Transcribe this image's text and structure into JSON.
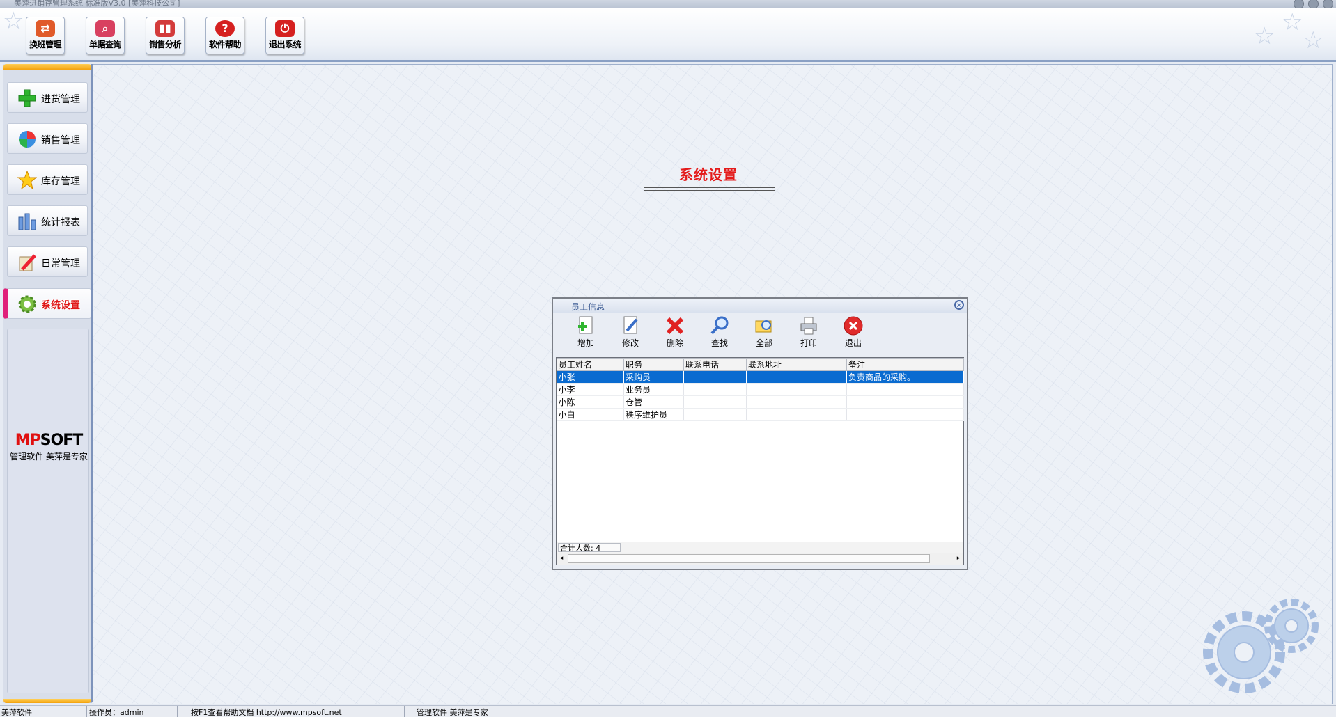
{
  "window": {
    "title": "美萍进销存管理系统 标准版V3.0 [美萍科技公司]"
  },
  "toolbar": {
    "buttons": [
      {
        "label": "换班管理",
        "icon": "shift-change-icon",
        "color": "#e05a2a"
      },
      {
        "label": "单据查询",
        "icon": "magnifier-icon",
        "color": "#d84060"
      },
      {
        "label": "销售分析",
        "icon": "bar-chart-icon",
        "color": "#d33b3b"
      },
      {
        "label": "软件帮助",
        "icon": "help-icon",
        "color": "#d52020"
      },
      {
        "label": "退出系统",
        "icon": "power-icon",
        "color": "#d52020"
      }
    ]
  },
  "sidebar": {
    "items": [
      {
        "label": "进货管理",
        "icon": "plus-icon"
      },
      {
        "label": "销售管理",
        "icon": "globe-icon"
      },
      {
        "label": "库存管理",
        "icon": "star-icon"
      },
      {
        "label": "统计报表",
        "icon": "bar-chart-icon"
      },
      {
        "label": "日常管理",
        "icon": "pencil-icon"
      },
      {
        "label": "系统设置",
        "icon": "gear-icon",
        "active": true
      }
    ],
    "logo": {
      "part1": "MP",
      "part2": "SOFT",
      "slogan": "管理软件 美萍是专家"
    }
  },
  "main": {
    "title": "系统设置"
  },
  "dialog": {
    "title": "员工信息",
    "tools": [
      {
        "label": "增加",
        "icon": "add-document-icon"
      },
      {
        "label": "修改",
        "icon": "edit-document-icon"
      },
      {
        "label": "删除",
        "icon": "delete-x-icon"
      },
      {
        "label": "查找",
        "icon": "search-icon"
      },
      {
        "label": "全部",
        "icon": "folder-search-icon"
      },
      {
        "label": "打印",
        "icon": "printer-icon"
      },
      {
        "label": "退出",
        "icon": "exit-icon"
      }
    ],
    "columns": [
      "员工姓名",
      "职务",
      "联系电话",
      "联系地址",
      "备注"
    ],
    "rows": [
      [
        "小张",
        "采购员",
        "",
        "",
        "负责商品的采购。"
      ],
      [
        "小李",
        "业务员",
        "",
        "",
        ""
      ],
      [
        "小陈",
        "仓管",
        "",
        "",
        ""
      ],
      [
        "小白",
        "秩序维护员",
        "",
        "",
        ""
      ]
    ],
    "selected_row": 0,
    "footer": "合计人数: 4"
  },
  "statusbar": {
    "app": "美萍软件",
    "operator": "操作员：admin",
    "help": "按F1查看帮助文档  http://www.mpsoft.net",
    "slogan": "管理软件 美萍是专家"
  },
  "colors": {
    "accent": "#e41b1b",
    "selection": "#0a6bd0",
    "frame": "#7d93bb"
  }
}
